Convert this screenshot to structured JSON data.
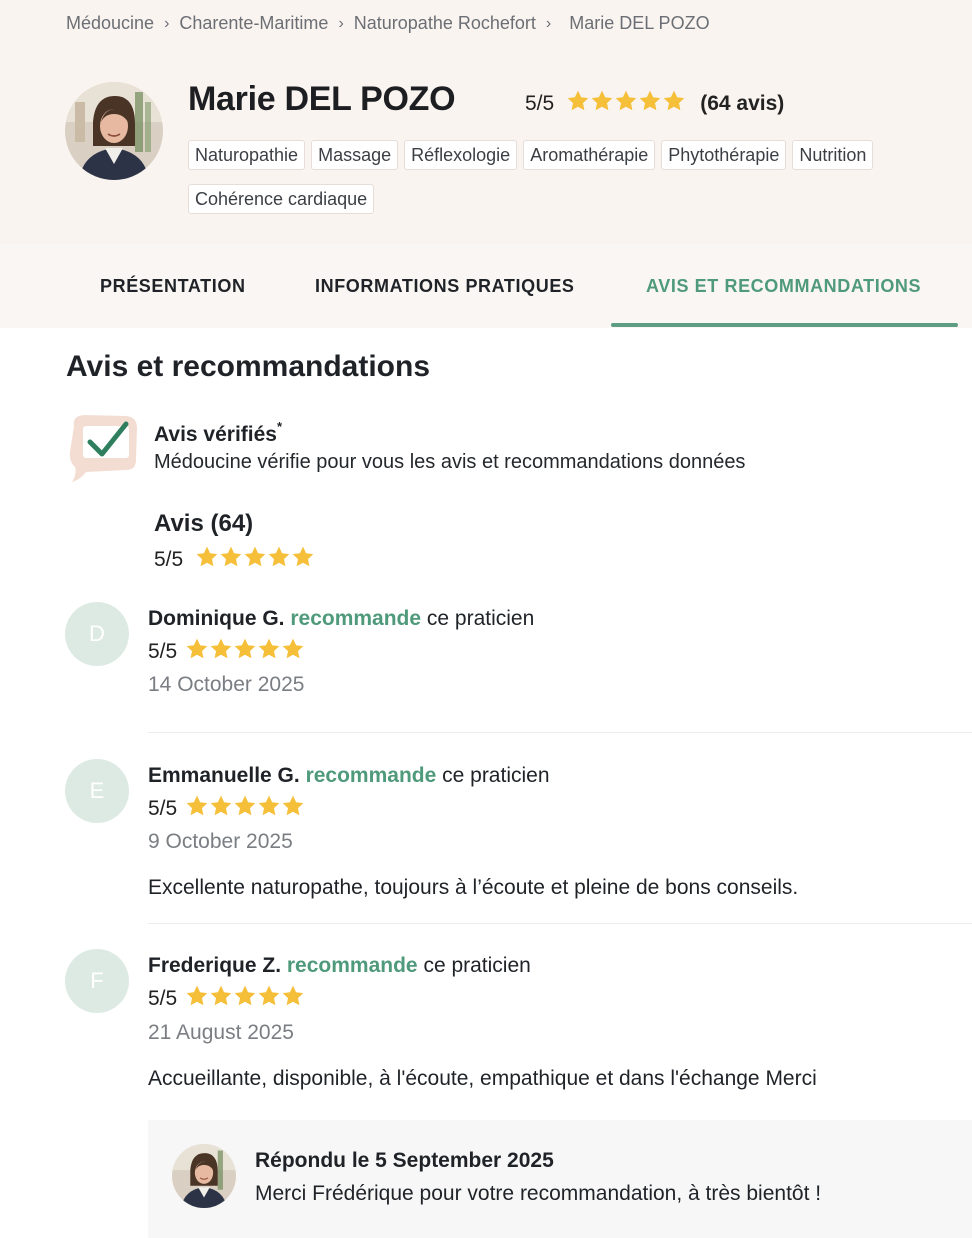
{
  "breadcrumb": {
    "items": [
      "Médoucine",
      "Charente-Maritime",
      "Naturopathe Rochefort"
    ],
    "current": "Marie DEL POZO"
  },
  "profile": {
    "name": "Marie DEL POZO",
    "rating_text": "5/5",
    "rating_value": 5,
    "review_count_text": "(64 avis)",
    "tags": [
      "Naturopathie",
      "Massage",
      "Réflexologie",
      "Aromathérapie",
      "Phytothérapie",
      "Nutrition",
      "Cohérence cardiaque"
    ]
  },
  "tabs": {
    "presentation": "PRÉSENTATION",
    "infos": "INFORMATIONS PRATIQUES",
    "avis": "AVIS ET RECOMMANDATIONS",
    "active": "avis"
  },
  "section": {
    "title": "Avis et recommandations"
  },
  "verified": {
    "title": "Avis vérifiés",
    "asterisk": "*",
    "text": "Médoucine vérifie pour vous les avis et recommandations données"
  },
  "summary": {
    "title": "Avis (64)",
    "rating_text": "5/5",
    "rating_value": 5
  },
  "reviews": [
    {
      "initial": "D",
      "author": "Dominique G.",
      "recommends": "recommande",
      "suffix": "ce praticien",
      "rating_text": "5/5",
      "rating_value": 5,
      "date": "14 October 2025",
      "text": ""
    },
    {
      "initial": "E",
      "author": "Emmanuelle G.",
      "recommends": "recommande",
      "suffix": "ce praticien",
      "rating_text": "5/5",
      "rating_value": 5,
      "date": "9 October 2025",
      "text": "Excellente naturopathe, toujours à l’écoute et pleine de bons conseils."
    },
    {
      "initial": "F",
      "author": "Frederique Z.",
      "recommends": "recommande",
      "suffix": "ce praticien",
      "rating_text": "5/5",
      "rating_value": 5,
      "date": "21 August 2025",
      "text": "Accueillante, disponible, à l'écoute, empathique et dans l'échange  Merci",
      "reply": {
        "title": "Répondu le 5 September 2025",
        "text": "Merci Frédérique pour votre recommandation, à très bientôt !"
      }
    }
  ],
  "colors": {
    "accent_green": "#4f9a7b",
    "star_yellow": "#f5bf3a",
    "header_bg": "#faf4f1",
    "initial_bg": "#ddeae4"
  },
  "icons": {
    "verified": "verified-check-bubble-icon",
    "star": "star-icon",
    "breadcrumb_sep": "chevron-right-icon"
  }
}
